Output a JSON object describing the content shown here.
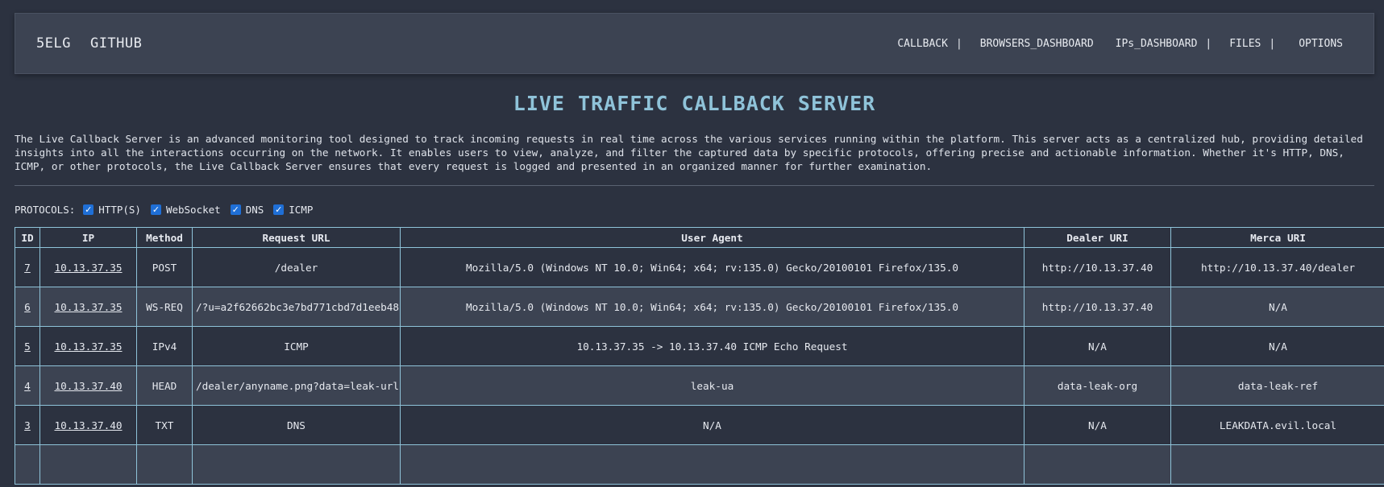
{
  "nav": {
    "brand": "5ELG",
    "github": "GITHUB",
    "links": [
      "CALLBACK",
      "BROWSERS_DASHBOARD",
      "IPs_DASHBOARD",
      "FILES",
      "OPTIONS"
    ],
    "sep": "|"
  },
  "title": "LIVE TRAFFIC CALLBACK SERVER",
  "description": [
    "The Live Callback Server is an advanced monitoring tool designed to track incoming requests in real time across the various services running within the platform. This server acts as a centralized hub, providing detailed",
    "insights into all the interactions occurring on the network. It enables users to view, analyze, and filter the captured data by specific protocols, offering precise and actionable information. Whether it's HTTP, DNS,",
    "ICMP, or other protocols, the Live Callback Server ensures that every request is logged and presented in an organized manner for further examination."
  ],
  "protocols": {
    "label": "PROTOCOLS:",
    "items": [
      {
        "label": "HTTP(S)",
        "checked": true
      },
      {
        "label": "WebSocket",
        "checked": true
      },
      {
        "label": "DNS",
        "checked": true
      },
      {
        "label": "ICMP",
        "checked": true
      }
    ]
  },
  "table": {
    "headers": [
      "ID",
      "IP",
      "Method",
      "Request URL",
      "User Agent",
      "Dealer URI",
      "Merca URI"
    ],
    "rows": [
      [
        "7",
        "10.13.37.35",
        "POST",
        "/dealer",
        "Mozilla/5.0 (Windows NT 10.0; Win64; x64; rv:135.0) Gecko/20100101 Firefox/135.0",
        "http://10.13.37.40",
        "http://10.13.37.40/dealer"
      ],
      [
        "6",
        "10.13.37.35",
        "WS-REQ",
        "/?u=a2f62662bc3e7bd771cbd7d1eeb48",
        "Mozilla/5.0 (Windows NT 10.0; Win64; x64; rv:135.0) Gecko/20100101 Firefox/135.0",
        "http://10.13.37.40",
        "N/A"
      ],
      [
        "5",
        "10.13.37.35",
        "IPv4",
        "ICMP",
        "10.13.37.35 -> 10.13.37.40 ICMP Echo Request",
        "N/A",
        "N/A"
      ],
      [
        "4",
        "10.13.37.40",
        "HEAD",
        "/dealer/anyname.png?data=leak-url",
        "leak-ua",
        "data-leak-org",
        "data-leak-ref"
      ],
      [
        "3",
        "10.13.37.40",
        "TXT",
        "DNS",
        "N/A",
        "N/A",
        "LEAKDATA.evil.local"
      ],
      [
        "",
        "",
        "",
        "",
        "",
        "",
        ""
      ]
    ]
  },
  "colors": {
    "background": "#2c3240",
    "panel": "#3c4352",
    "accent": "#8fc3d9",
    "checkbox": "#1f6fd6"
  },
  "icons": {
    "checkbox": "checkmark-icon"
  }
}
